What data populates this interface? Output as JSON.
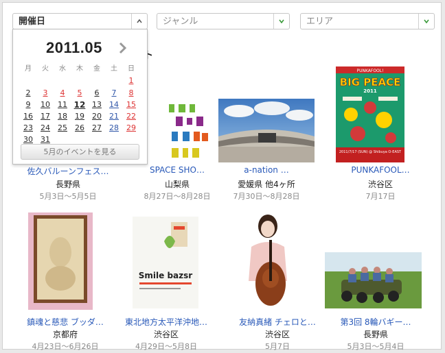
{
  "filters": {
    "date": {
      "label": "開催日"
    },
    "genre": {
      "label": "ジャンル"
    },
    "area": {
      "label": "エリア"
    }
  },
  "calendar": {
    "month": "2011.05",
    "weekdays": [
      "月",
      "火",
      "水",
      "木",
      "金",
      "土",
      "日"
    ],
    "days": [
      "1",
      "2",
      "3",
      "4",
      "5",
      "6",
      "7",
      "8",
      "9",
      "10",
      "11",
      "12",
      "13",
      "14",
      "15",
      "16",
      "17",
      "18",
      "19",
      "20",
      "21",
      "22",
      "23",
      "24",
      "25",
      "26",
      "27",
      "28",
      "29",
      "30",
      "31"
    ],
    "show_button": "5月のイベントを見る"
  },
  "section": {
    "heading_fragment": "ント"
  },
  "events": [
    {
      "title": "佐久バルーンフェス…",
      "location": "長野県",
      "dates": "5月3日〜5月5日"
    },
    {
      "title": "SPACE SHO…",
      "location": "山梨県",
      "dates": "8月27日〜8月28日"
    },
    {
      "title": "a-nation …",
      "location": "愛媛県 他4ヶ所",
      "dates": "7月30日〜8月28日"
    },
    {
      "title": "PUNKAFOOL…",
      "location": "渋谷区",
      "dates": "7月17日"
    },
    {
      "title": "鎮魂と慈悲 ブッダ…",
      "location": "京都府",
      "dates": "4月23日〜6月26日"
    },
    {
      "title": "東北地方太平洋沖地…",
      "location": "渋谷区",
      "dates": "4月29日〜5月8日"
    },
    {
      "title": "友納真緒 チェロと…",
      "location": "渋谷区",
      "dates": "5月7日"
    },
    {
      "title": "第3回 8輪バギー…",
      "location": "長野県",
      "dates": "5月3日〜5月4日"
    }
  ],
  "poster_text": {
    "bigpeace_top": "PUNKAFOOL!",
    "bigpeace_title": "BIG PEACE",
    "bigpeace_year": "2011",
    "bigpeace_bottom": "2011/7/17 (SUN) @ Shibuya O-EAST",
    "smile": "Smile bazsr"
  },
  "colors": {
    "link": "#2858b8",
    "sunday": "#dd3333",
    "saturday": "#2f56a8"
  }
}
